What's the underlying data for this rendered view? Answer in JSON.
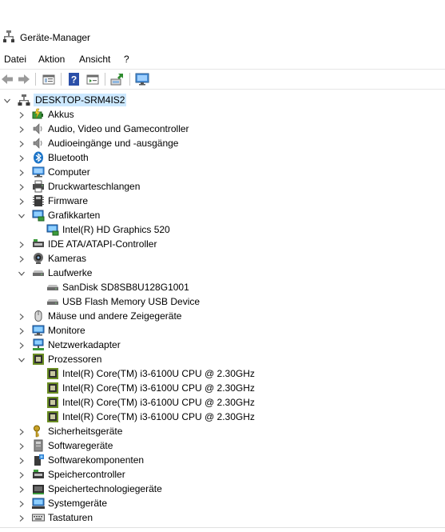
{
  "window": {
    "title": "Geräte-Manager"
  },
  "menu": [
    "Datei",
    "Aktion",
    "Ansicht",
    "?"
  ],
  "tree": {
    "root": "DESKTOP-SRM4IS2",
    "items": [
      {
        "label": "Akkus",
        "icon": "battery-icon",
        "expanded": false
      },
      {
        "label": "Audio, Video und Gamecontroller",
        "icon": "speaker-icon",
        "expanded": false
      },
      {
        "label": "Audioeingänge und -ausgänge",
        "icon": "speaker-icon",
        "expanded": false
      },
      {
        "label": "Bluetooth",
        "icon": "bluetooth-icon",
        "expanded": false
      },
      {
        "label": "Computer",
        "icon": "computer-icon",
        "expanded": false
      },
      {
        "label": "Druckwarteschlangen",
        "icon": "printer-icon",
        "expanded": false
      },
      {
        "label": "Firmware",
        "icon": "firmware-icon",
        "expanded": false
      },
      {
        "label": "Grafikkarten",
        "icon": "display-adapter-icon",
        "expanded": true,
        "children": [
          "Intel(R) HD Graphics 520"
        ]
      },
      {
        "label": "IDE ATA/ATAPI-Controller",
        "icon": "ide-controller-icon",
        "expanded": false
      },
      {
        "label": "Kameras",
        "icon": "camera-icon",
        "expanded": false
      },
      {
        "label": "Laufwerke",
        "icon": "drive-icon",
        "expanded": true,
        "children": [
          "SanDisk SD8SB8U128G1001",
          "USB Flash Memory USB Device"
        ]
      },
      {
        "label": "Mäuse und andere Zeigegeräte",
        "icon": "mouse-icon",
        "expanded": false
      },
      {
        "label": "Monitore",
        "icon": "monitor-icon",
        "expanded": false
      },
      {
        "label": "Netzwerkadapter",
        "icon": "network-adapter-icon",
        "expanded": false
      },
      {
        "label": "Prozessoren",
        "icon": "processor-icon",
        "expanded": true,
        "children": [
          "Intel(R) Core(TM) i3-6100U CPU @ 2.30GHz",
          "Intel(R) Core(TM) i3-6100U CPU @ 2.30GHz",
          "Intel(R) Core(TM) i3-6100U CPU @ 2.30GHz",
          "Intel(R) Core(TM) i3-6100U CPU @ 2.30GHz"
        ]
      },
      {
        "label": "Sicherheitsgeräte",
        "icon": "security-key-icon",
        "expanded": false
      },
      {
        "label": "Softwaregeräte",
        "icon": "software-device-icon",
        "expanded": false
      },
      {
        "label": "Softwarekomponenten",
        "icon": "software-component-icon",
        "expanded": false
      },
      {
        "label": "Speichercontroller",
        "icon": "storage-controller-icon",
        "expanded": false
      },
      {
        "label": "Speichertechnologiegeräte",
        "icon": "storage-tech-icon",
        "expanded": false
      },
      {
        "label": "Systemgeräte",
        "icon": "system-device-icon",
        "expanded": false
      },
      {
        "label": "Tastaturen",
        "icon": "keyboard-icon",
        "expanded": false
      }
    ]
  },
  "colors": {
    "selection": "#cce8ff",
    "accent": "#1a73c7"
  }
}
